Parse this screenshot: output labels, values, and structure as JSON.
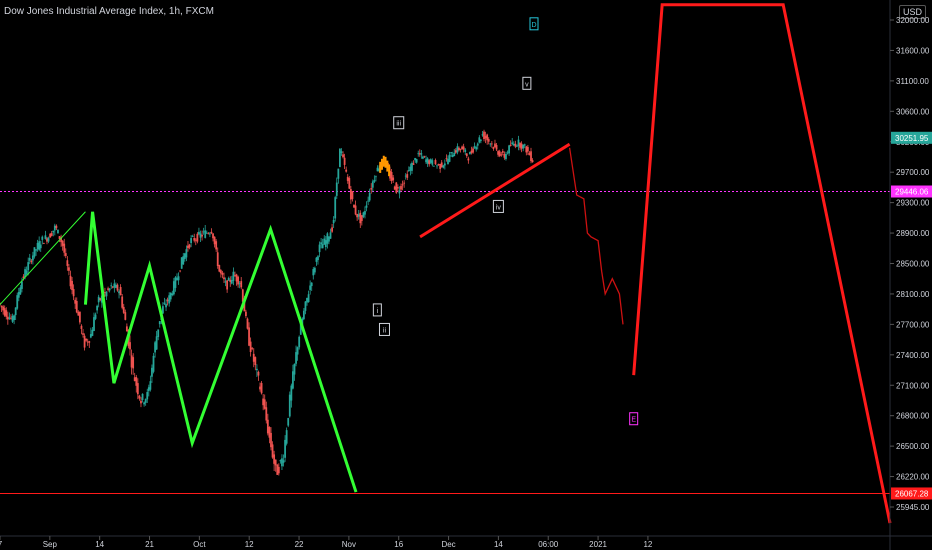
{
  "header": {
    "title": "Dow Jones Industrial Average Index, 1h, FXCM"
  },
  "currency": "USD",
  "colors": {
    "background": "#000000",
    "up_candle": "#26a69a",
    "down_candle": "#ef5350",
    "green_path": "#33ff33",
    "red_path": "#ff1a1a",
    "dotted_level": "#ff33ff",
    "axis_text": "#d1d4dc"
  },
  "chart_data": {
    "type": "candlestick",
    "title": "Dow Jones Industrial Average Index, 1h, FXCM",
    "ylim": [
      25800,
      32200
    ],
    "y_ticks": [
      32000,
      31600,
      31100,
      30600,
      30200,
      29700,
      29300,
      28900,
      28500,
      28100,
      27700,
      27400,
      27100,
      26800,
      26500,
      26220,
      25945
    ],
    "y_tick_labels": [
      "32000.00",
      "31600.00",
      "31100.00",
      "30600.00",
      "30200.00",
      "29700.00",
      "29300.00",
      "28900.00",
      "28500.00",
      "28100.00",
      "27700.00",
      "27400.00",
      "27100.00",
      "26800.00",
      "26500.00",
      "26220.00",
      "25945.00"
    ],
    "x_ticks": [
      {
        "label": "7",
        "t": 0
      },
      {
        "label": "Sep",
        "t": 7
      },
      {
        "label": "14",
        "t": 14
      },
      {
        "label": "21",
        "t": 21
      },
      {
        "label": "Oct",
        "t": 28
      },
      {
        "label": "12",
        "t": 35
      },
      {
        "label": "22",
        "t": 42
      },
      {
        "label": "Nov",
        "t": 49
      },
      {
        "label": "16",
        "t": 56
      },
      {
        "label": "Dec",
        "t": 63
      },
      {
        "label": "14",
        "t": 70
      },
      {
        "label": "06:00",
        "t": 77
      },
      {
        "label": "2021",
        "t": 84
      },
      {
        "label": "12",
        "t": 91
      }
    ],
    "price_labels": [
      {
        "label": "30251.95",
        "value": 30251.95,
        "color": "#26a69a"
      },
      {
        "label": "29446.06",
        "value": 29446.06,
        "color": "#ff33ff"
      },
      {
        "label": "26067.28",
        "value": 26067.28,
        "color": "#ff1a1a"
      }
    ],
    "levels": [
      {
        "value": 29446.06,
        "style": "dotted",
        "color": "#ff33ff"
      },
      {
        "value": 26067.28,
        "style": "solid",
        "color": "#ff1a1a"
      }
    ],
    "price_path": [
      [
        0,
        27980
      ],
      [
        1,
        27850
      ],
      [
        2,
        27750
      ],
      [
        3,
        28200
      ],
      [
        4,
        28450
      ],
      [
        5,
        28650
      ],
      [
        6,
        28800
      ],
      [
        7,
        28850
      ],
      [
        8,
        28980
      ],
      [
        9,
        28750
      ],
      [
        10,
        28300
      ],
      [
        11,
        27900
      ],
      [
        12,
        27500
      ],
      [
        13,
        27600
      ],
      [
        14,
        28000
      ],
      [
        15,
        28100
      ],
      [
        16,
        28200
      ],
      [
        17,
        28150
      ],
      [
        18,
        27650
      ],
      [
        19,
        27200
      ],
      [
        20,
        26950
      ],
      [
        21,
        27000
      ],
      [
        22,
        27500
      ],
      [
        23,
        27900
      ],
      [
        24,
        28050
      ],
      [
        25,
        28300
      ],
      [
        26,
        28600
      ],
      [
        27,
        28800
      ],
      [
        28,
        28850
      ],
      [
        29,
        28900
      ],
      [
        30,
        28950
      ],
      [
        31,
        28400
      ],
      [
        32,
        28200
      ],
      [
        33,
        28350
      ],
      [
        34,
        28250
      ],
      [
        35,
        27600
      ],
      [
        36,
        27300
      ],
      [
        37,
        27000
      ],
      [
        38,
        26600
      ],
      [
        39,
        26250
      ],
      [
        40,
        26400
      ],
      [
        41,
        27000
      ],
      [
        42,
        27500
      ],
      [
        43,
        27900
      ],
      [
        44,
        28300
      ],
      [
        45,
        28700
      ],
      [
        46,
        28800
      ],
      [
        47,
        29000
      ],
      [
        48,
        30100
      ],
      [
        49,
        29600
      ],
      [
        50,
        29200
      ],
      [
        51,
        29050
      ],
      [
        52,
        29400
      ],
      [
        53,
        29700
      ],
      [
        54,
        29900
      ],
      [
        55,
        29650
      ],
      [
        56,
        29450
      ],
      [
        57,
        29600
      ],
      [
        58,
        29800
      ],
      [
        59,
        30000
      ],
      [
        60,
        29900
      ],
      [
        61,
        29850
      ],
      [
        62,
        29800
      ],
      [
        63,
        29900
      ],
      [
        64,
        30050
      ],
      [
        65,
        30100
      ],
      [
        66,
        29950
      ],
      [
        67,
        30150
      ],
      [
        68,
        30300
      ],
      [
        69,
        30200
      ],
      [
        70,
        30050
      ],
      [
        71,
        29950
      ],
      [
        72,
        30150
      ],
      [
        73,
        30180
      ],
      [
        74,
        30100
      ],
      [
        75,
        29900
      ]
    ],
    "annotations": [
      {
        "label": "D",
        "t": 75,
        "value": 31950,
        "color": "#26c6da"
      },
      {
        "label": "v",
        "t": 74,
        "value": 31060,
        "color": "#d1d4dc"
      },
      {
        "label": "iii",
        "t": 56,
        "value": 30450,
        "color": "#d1d4dc"
      },
      {
        "label": "iv",
        "t": 70,
        "value": 29250,
        "color": "#d1d4dc"
      },
      {
        "label": "i",
        "t": 53,
        "value": 27890,
        "color": "#d1d4dc"
      },
      {
        "label": "ii",
        "t": 54,
        "value": 27650,
        "color": "#d1d4dc"
      },
      {
        "label": "E",
        "t": 89,
        "value": 26770,
        "color": "#ff33ff"
      }
    ],
    "green_pattern": [
      [
        12,
        27960
      ],
      [
        13,
        29180
      ],
      [
        16,
        27120
      ],
      [
        21,
        28470
      ],
      [
        27,
        26530
      ],
      [
        38,
        28950
      ],
      [
        50,
        26080
      ]
    ],
    "green_trend": [
      [
        0,
        27960
      ],
      [
        12,
        29180
      ]
    ],
    "red_trendline": [
      [
        59,
        28850
      ],
      [
        80,
        30160
      ]
    ],
    "red_projection": [
      [
        89,
        27200
      ],
      [
        93,
        32200
      ],
      [
        110,
        32200
      ],
      [
        125,
        25800
      ]
    ],
    "red_forecast": [
      [
        80,
        30100
      ],
      [
        81,
        29400
      ],
      [
        82,
        29350
      ],
      [
        82.5,
        28900
      ],
      [
        83,
        28850
      ],
      [
        84,
        28800
      ],
      [
        84.5,
        28400
      ],
      [
        85,
        28100
      ],
      [
        86,
        28300
      ],
      [
        87,
        28100
      ],
      [
        87.5,
        27700
      ]
    ]
  }
}
